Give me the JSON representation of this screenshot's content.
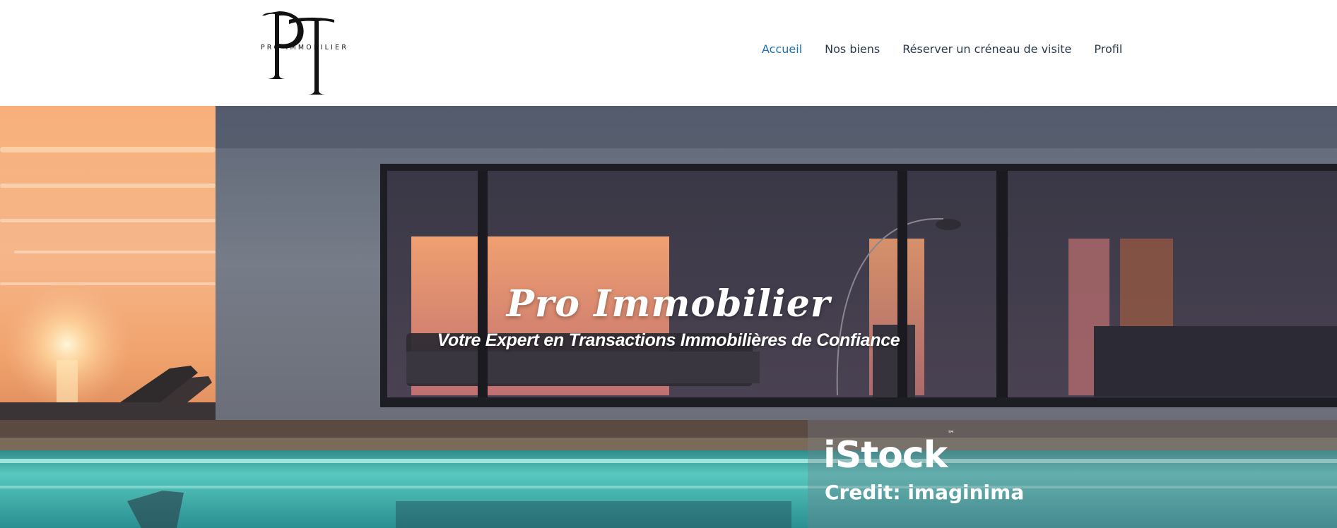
{
  "brand": {
    "logo_text": "PRO IMMOBILIER",
    "monogram": "PI"
  },
  "nav": {
    "items": [
      {
        "label": "Accueil",
        "active": true
      },
      {
        "label": "Nos biens",
        "active": false
      },
      {
        "label": "Réserver un créneau de visite",
        "active": false
      },
      {
        "label": "Profil",
        "active": false
      }
    ]
  },
  "hero": {
    "title": "Pro Immobilier",
    "subtitle": "Votre Expert en Transactions Immobilières de Confiance",
    "watermark": {
      "brand": "iStock",
      "tm": "™",
      "credit": "Credit: imaginima"
    }
  },
  "colors": {
    "nav_active": "#1f6fb4",
    "nav_default": "#2b3a4a",
    "sky": "#f4a574",
    "pool": "#3fb0a8"
  }
}
